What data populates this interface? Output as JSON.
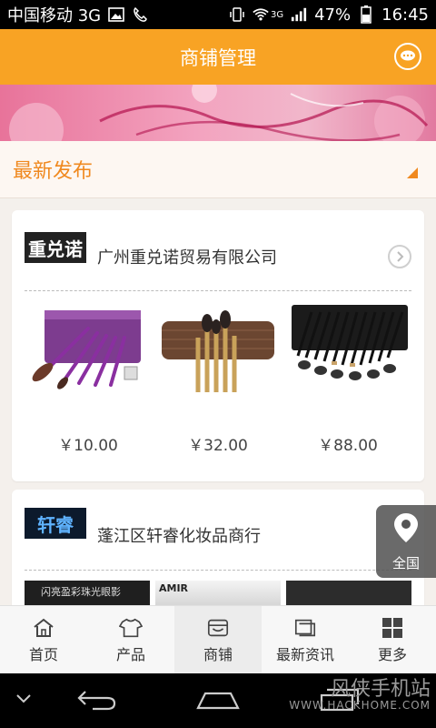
{
  "status_bar": {
    "carrier": "中国移动 3G",
    "signal_tag": "3G",
    "battery": "47%",
    "time": "16:45"
  },
  "header": {
    "title": "商铺管理",
    "chat_icon": "chat-bubble-icon"
  },
  "section": {
    "title": "最新发布"
  },
  "shops": [
    {
      "logo_text": "重兑诺",
      "name": "广州重兑诺贸易有限公司",
      "products": [
        {
          "price": "￥10.00"
        },
        {
          "price": "￥32.00"
        },
        {
          "price": "￥88.00"
        }
      ]
    },
    {
      "logo_text": "轩睿",
      "name": "蓬江区轩睿化妆品商行",
      "thumb_texts": [
        "闪亮盈彩珠光眼影",
        "AMIR"
      ]
    }
  ],
  "floating_button": {
    "label": "全国",
    "icon": "location-pin-icon"
  },
  "bottom_nav": [
    {
      "label": "首页",
      "icon": "home-icon"
    },
    {
      "label": "产品",
      "icon": "shirt-icon"
    },
    {
      "label": "商铺",
      "icon": "shop-icon",
      "active": true
    },
    {
      "label": "最新资讯",
      "icon": "news-icon"
    },
    {
      "label": "更多",
      "icon": "grid-icon"
    }
  ],
  "watermark": {
    "brand": "风侠手机站",
    "url": "WWW.HACKHOME.COM"
  },
  "colors": {
    "brand_orange": "#f8a324",
    "section_orange": "#f0891f"
  }
}
